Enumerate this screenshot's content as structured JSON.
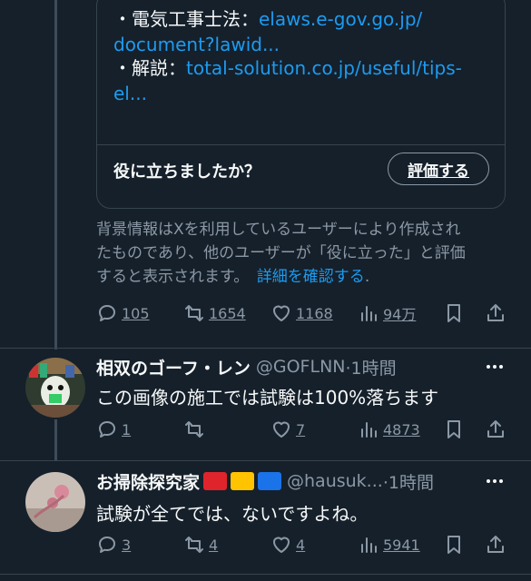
{
  "note": {
    "lines": [
      {
        "bullet": "・電気工事士法：",
        "link": "elaws.e-gov.go.jp/"
      },
      {
        "bullet": "",
        "link": "document?lawid..."
      },
      {
        "bullet": "・解説：",
        "link": "total-solution.co.jp/useful/tips-"
      },
      {
        "bullet": "",
        "link": "el..."
      }
    ],
    "question": "役に立ちましたか？",
    "rate_button": "評価する",
    "disclaimer_lines": [
      "背景情報はXを利用しているユーザーにより作成され",
      "たものであり、他のユーザーが「役に立った」と評価",
      "すると表示されます。"
    ],
    "disclaimer_link": "詳細を確認する",
    "disclaimer_end": "."
  },
  "main_actions": {
    "replies": "105",
    "reposts": "1654",
    "likes": "1168",
    "views": "94万"
  },
  "replies": [
    {
      "name": "相双のゴーフ・レン",
      "handle": "@GOFLNN",
      "time": "·1時間",
      "text": "この画像の施工では試験は100%落ちます",
      "replies": "1",
      "reposts": "",
      "likes": "7",
      "views": "4873"
    },
    {
      "name": "お掃除探究家",
      "flags": [
        "#e0242c",
        "#ffc300",
        "#1a73e8"
      ],
      "handle": "@hausuk...",
      "time": "·1時間",
      "text": "試験が全てでは、ないですよね。",
      "replies": "3",
      "reposts": "4",
      "likes": "4",
      "views": "5941"
    }
  ]
}
